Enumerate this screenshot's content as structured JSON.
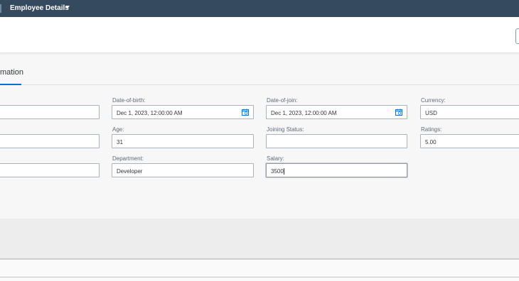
{
  "topbar": {
    "title": "Employee Details",
    "menu_icon": "chevron-down-icon"
  },
  "tabs": [
    {
      "label": "mation",
      "selected": true
    }
  ],
  "form": {
    "date_of_birth": {
      "label": "Date-of-birth:",
      "value": "Dec 1, 2023, 12:00:00 AM"
    },
    "date_of_join": {
      "label": "Date-of-join:",
      "value": "Dec 1, 2023, 12:00:00 AM"
    },
    "currency": {
      "label": "Currency:",
      "value": "USD"
    },
    "age": {
      "label": "Age:",
      "value": "31"
    },
    "joining_status": {
      "label": "Joining Status:",
      "value": ""
    },
    "ratings": {
      "label": "Ratings:",
      "value": "5.00"
    },
    "department": {
      "label": "Department:",
      "value": "Developer"
    },
    "salary": {
      "label": "Salary:",
      "value": "3500"
    }
  },
  "colors": {
    "shell_bar": "#354a5f",
    "accent": "#0a6ed1",
    "icon_blue": "#0a6ed1"
  }
}
